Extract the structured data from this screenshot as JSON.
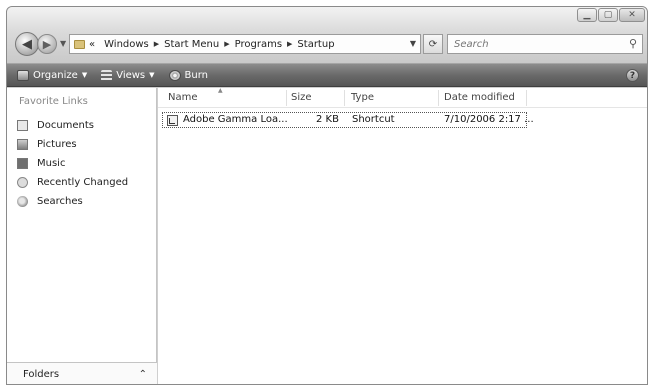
{
  "window": {
    "caption_buttons": [
      "minimize",
      "maximize",
      "close"
    ]
  },
  "nav": {
    "back_icon": "back-arrow-icon",
    "forward_icon": "forward-arrow-icon"
  },
  "address": {
    "overflow": "«",
    "crumbs": [
      "Windows",
      "Start Menu",
      "Programs",
      "Startup"
    ]
  },
  "search": {
    "placeholder": "Search"
  },
  "toolbar": {
    "organize": "Organize",
    "views": "Views",
    "burn": "Burn"
  },
  "favorites": {
    "title": "Favorite Links",
    "items": [
      "Documents",
      "Pictures",
      "Music",
      "Recently Changed",
      "Searches"
    ]
  },
  "folders_bar": {
    "label": "Folders"
  },
  "columns": [
    "Name",
    "Size",
    "Type",
    "Date modified"
  ],
  "files": [
    {
      "name": "Adobe Gamma Loa...",
      "size": "2 KB",
      "type": "Shortcut",
      "date": "7/10/2006 2:17 ..."
    }
  ]
}
